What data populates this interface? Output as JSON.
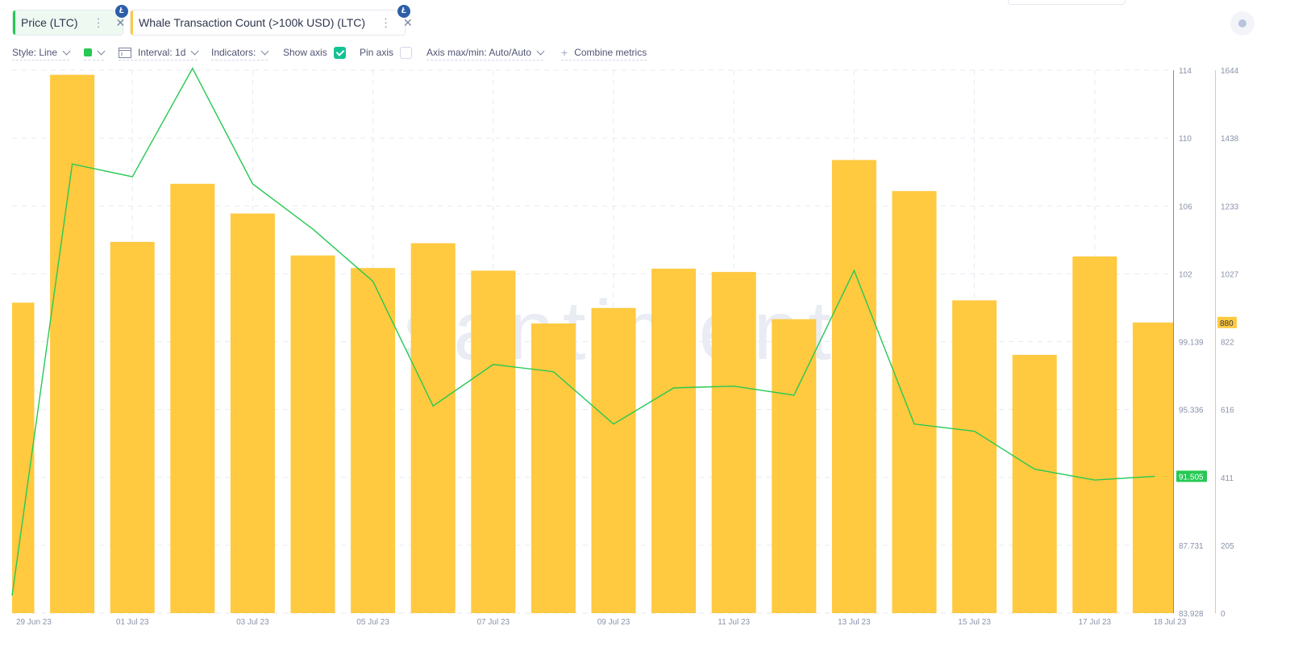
{
  "metrics": [
    {
      "label": "Price (LTC)",
      "color": "#26c953",
      "badge": "Ł"
    },
    {
      "label": "Whale Transaction Count (>100k USD) (LTC)",
      "color": "#ffc940",
      "badge": "Ł"
    }
  ],
  "toolbar": {
    "style_label": "Style: Line",
    "interval_label": "Interval: 1d",
    "indicators_label": "Indicators:",
    "show_axis_label": "Show axis",
    "show_axis_checked": true,
    "pin_axis_label": "Pin axis",
    "pin_axis_checked": false,
    "axis_minmax_label": "Axis max/min: Auto/Auto",
    "combine_label": "Combine metrics",
    "series_color": "#26c953"
  },
  "watermark": "santiment.",
  "chart_data": {
    "type": "bar",
    "x": [
      "29 Jun 23",
      "30 Jun 23",
      "01 Jul 23",
      "02 Jul 23",
      "03 Jul 23",
      "04 Jul 23",
      "05 Jul 23",
      "06 Jul 23",
      "07 Jul 23",
      "08 Jul 23",
      "09 Jul 23",
      "10 Jul 23",
      "11 Jul 23",
      "12 Jul 23",
      "13 Jul 23",
      "14 Jul 23",
      "15 Jul 23",
      "16 Jul 23",
      "17 Jul 23",
      "18 Jul 23"
    ],
    "x_tick_labels": [
      "29 Jun 23",
      "01 Jul 23",
      "03 Jul 23",
      "05 Jul 23",
      "07 Jul 23",
      "09 Jul 23",
      "11 Jul 23",
      "13 Jul 23",
      "15 Jul 23",
      "17 Jul 23",
      "18 Jul 23"
    ],
    "series": [
      {
        "name": "Whale Transaction Count (>100k USD) (LTC)",
        "type": "bar",
        "color": "#ffc940",
        "axis": "right-outer",
        "values": [
          940,
          1630,
          1124,
          1300,
          1210,
          1083,
          1045,
          1120,
          1037,
          877,
          924,
          1043,
          1033,
          890,
          1372,
          1278,
          947,
          782,
          1080,
          880
        ]
      },
      {
        "name": "Price (LTC)",
        "type": "line",
        "color": "#26c953",
        "axis": "right-inner",
        "values": [
          84.9,
          108.8,
          108.1,
          114.1,
          107.7,
          105.2,
          102.3,
          95.4,
          97.7,
          97.3,
          94.4,
          96.4,
          96.5,
          96.0,
          102.9,
          94.4,
          94.0,
          91.9,
          91.3,
          91.505
        ]
      }
    ],
    "price_axis": {
      "ylim": [
        83.928,
        114
      ],
      "ticks": [
        "114",
        "110",
        "106",
        "102",
        "99.139",
        "95.336",
        "91.505",
        "87.731",
        "83.928"
      ],
      "current": "91.505"
    },
    "count_axis": {
      "ylim": [
        0,
        1644
      ],
      "ticks": [
        "1644",
        "1438",
        "1233",
        "1027",
        "822",
        "616",
        "411",
        "205",
        "0"
      ],
      "current": "880"
    },
    "grid": true
  }
}
